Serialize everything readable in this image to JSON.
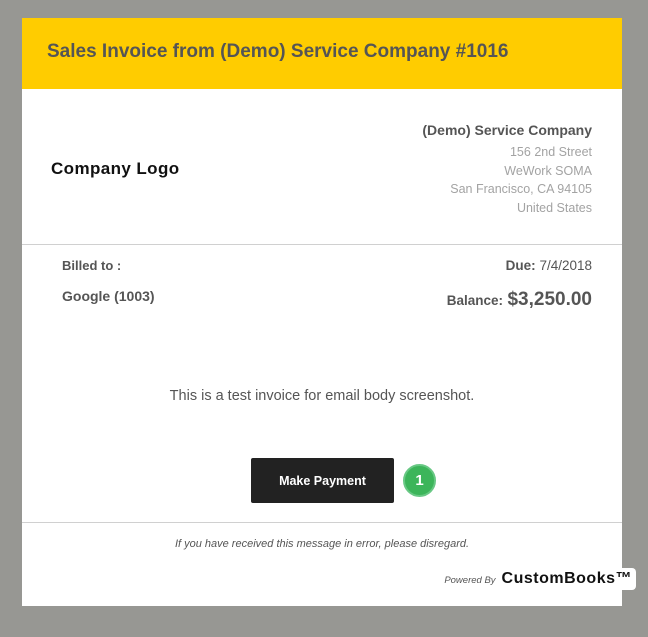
{
  "header": {
    "title": "Sales Invoice from (Demo) Service Company #1016"
  },
  "logo": {
    "text": "Company Logo"
  },
  "company": {
    "name": "(Demo) Service Company",
    "address": [
      "156 2nd Street",
      "WeWork SOMA",
      "San Francisco, CA  94105",
      "United States"
    ]
  },
  "billing": {
    "billed_to_label": "Billed to :",
    "customer": "Google (1003)",
    "due_label": "Due:",
    "due_date": "7/4/2018",
    "balance_label": "Balance:",
    "balance_amount": "$3,250.00"
  },
  "message": "This is a test invoice for email body screenshot.",
  "actions": {
    "make_payment": "Make Payment"
  },
  "annotation": {
    "step_number": "1"
  },
  "footer": {
    "note": "If you have received this message in error, please disregard.",
    "powered_by": "Powered By",
    "brand": "CustomBooks™"
  },
  "colors": {
    "accent": "#ffcc00",
    "button": "#222222",
    "badge": "#3cb55a",
    "backdrop": "#979793"
  }
}
